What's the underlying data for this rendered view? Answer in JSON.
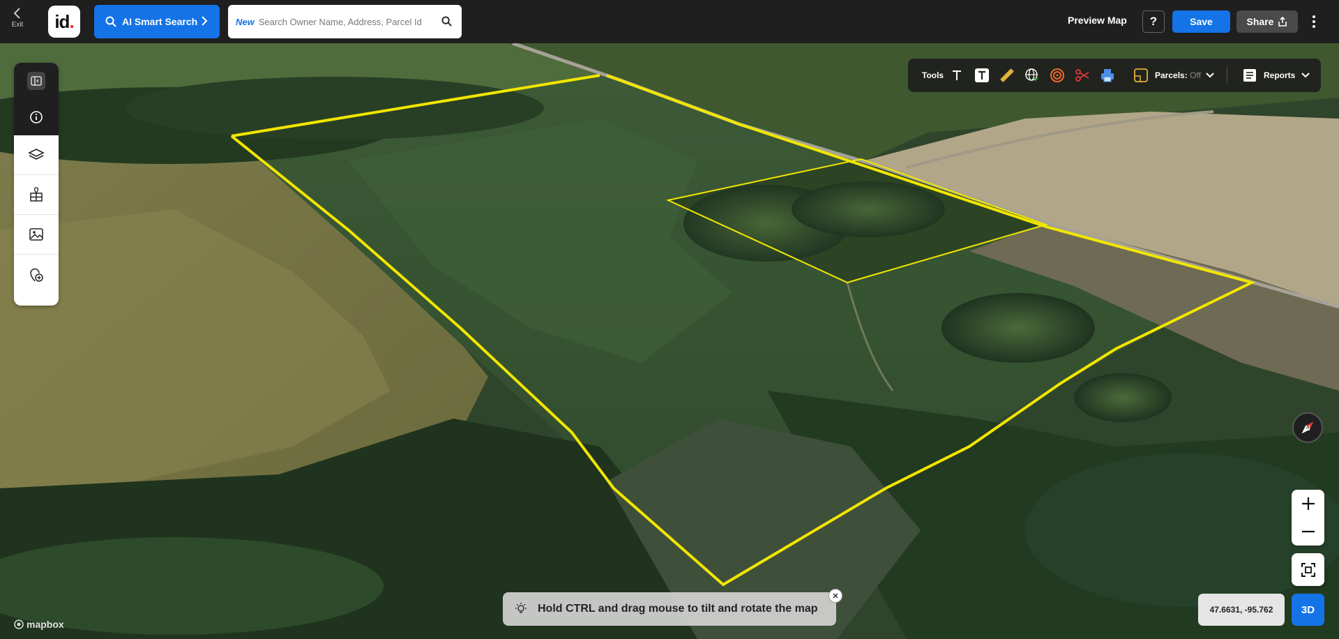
{
  "topbar": {
    "exit_label": "Exit",
    "logo_text": "id",
    "ai_search_label": "AI Smart Search",
    "search_badge": "New",
    "search_placeholder": "Search Owner Name, Address, Parcel Id",
    "preview_label": "Preview Map",
    "help_label": "?",
    "save_label": "Save",
    "share_label": "Share"
  },
  "sidebar": {
    "items": [
      {
        "icon": "panel-toggle-icon"
      },
      {
        "icon": "info-icon"
      },
      {
        "icon": "layers-icon"
      },
      {
        "icon": "parcel-buildings-icon"
      },
      {
        "icon": "image-icon"
      },
      {
        "icon": "add-location-icon"
      }
    ]
  },
  "tools": {
    "label": "Tools",
    "items": [
      "text-icon",
      "text-box-icon",
      "ruler-icon",
      "globe-cursor-icon",
      "radius-icon",
      "scissors-icon",
      "print-icon",
      "parcel-icon"
    ],
    "parcels_label": "Parcels:",
    "parcels_state": "Off",
    "reports_label": "Reports"
  },
  "map": {
    "coordinates": "47.6631, -95.762",
    "mode_label": "3D",
    "hint": "Hold CTRL and drag mouse to tilt and rotate the map",
    "attribution": "mapbox"
  },
  "colors": {
    "accent": "#1473e6",
    "parcel_outline": "#f2e600",
    "topbar": "#1f1f1f"
  }
}
